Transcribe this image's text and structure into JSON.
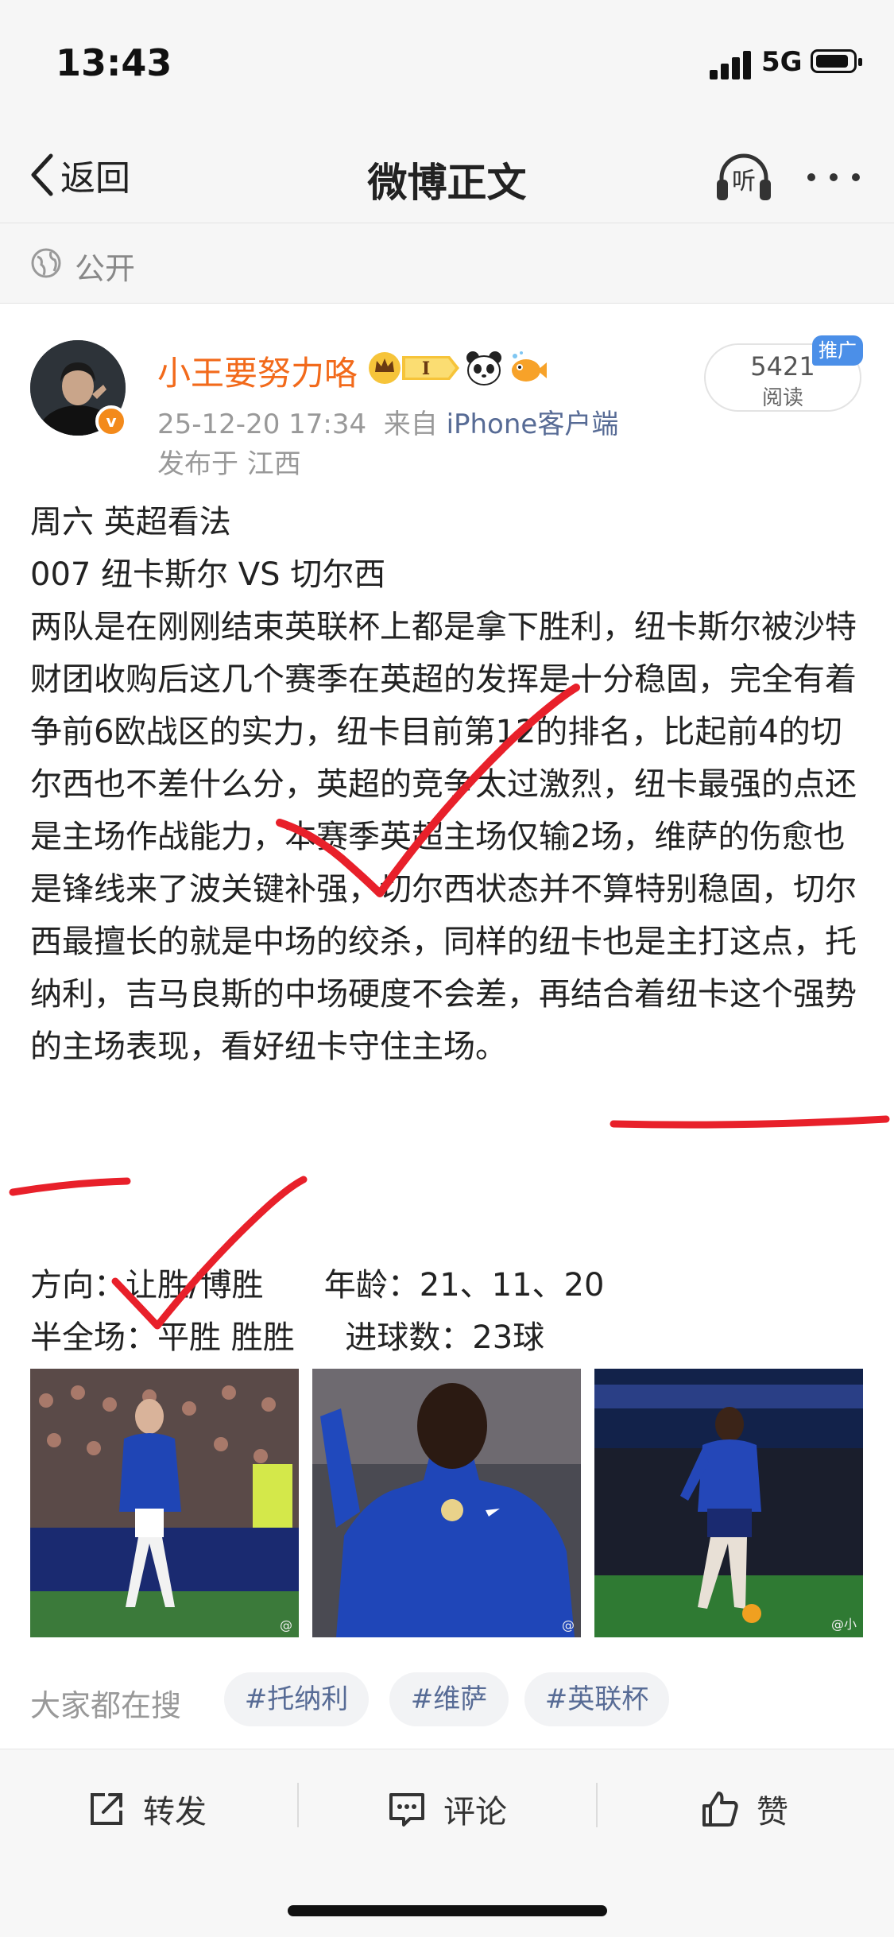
{
  "status_bar": {
    "time": "13:43",
    "network": "5G"
  },
  "nav": {
    "back_label": "返回",
    "title": "微博正文",
    "listen_label": "听"
  },
  "visibility": {
    "label": "公开"
  },
  "author": {
    "name": "小王要努力咯",
    "level_badge": "I",
    "timestamp": "25-12-20 17:34",
    "source_prefix": "来自",
    "source": "iPhone客户端",
    "location": "发布于 江西",
    "verified_mark": "v"
  },
  "reads": {
    "count": "5421",
    "label": "阅读",
    "promo_tag": "推广"
  },
  "post": {
    "lines": [
      "周六  英超看法",
      "007  纽卡斯尔 VS 切尔西",
      "两队是在刚刚结束英联杯上都是拿下胜利，纽卡斯尔被沙特财团收购后这几个赛季在英超的发挥是十分稳固，完全有着争前6欧战区的实力，纽卡目前第12的排名，比起前4的切尔西也不差什么分，英超的竞争太过激烈，纽卡最强的点还是主场作战能力，本赛季英超主场仅输2场，维萨的伤愈也是锋线来了波关键补强，切尔西状态并不算特别稳固，切尔西最擅长的就是中场的绞杀，同样的纽卡也是主打这点，托纳利，吉马良斯的中场硬度不会差，再结合着纽卡这个强势的主场表现，"
    ],
    "highlight": "看好纽卡守住主场。",
    "stats_line_1": "方向：让胜/博胜      年龄：21、11、20",
    "stats_line_2": "半全场：平胜 胜胜     进球数：23球"
  },
  "photos": [
    {
      "name": "photo-1",
      "watermark": "@"
    },
    {
      "name": "photo-2",
      "watermark": "@"
    },
    {
      "name": "photo-3",
      "watermark": "@小"
    }
  ],
  "trending": {
    "label": "大家都在搜",
    "tags": [
      "#托纳利",
      "#维萨",
      "#英联杯"
    ]
  },
  "actions": {
    "repost": "转发",
    "comment": "评论",
    "like": "赞"
  },
  "colors": {
    "username": "#f26a1b",
    "link": "#576b95",
    "promo": "#4b8fe8",
    "pen": "#e8202a"
  }
}
